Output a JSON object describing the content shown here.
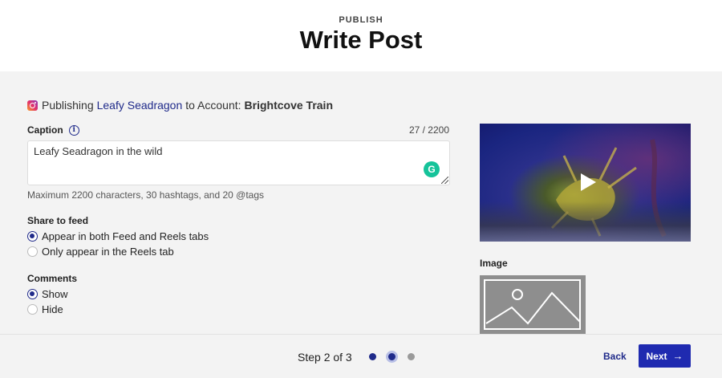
{
  "header": {
    "eyebrow": "PUBLISH",
    "title": "Write Post"
  },
  "publish_line": {
    "prefix": "Publishing",
    "video_name": "Leafy Seadragon",
    "middle": "to Account:",
    "account": "Brightcove Train"
  },
  "caption": {
    "label": "Caption",
    "info_icon": "i",
    "count": "27 / 2200",
    "value": "Leafy Seadragon in the wild",
    "grammarly_icon": "G",
    "helper": "Maximum 2200 characters, 30 hashtags, and 20 @tags"
  },
  "share_to_feed": {
    "label": "Share to feed",
    "options": [
      {
        "label": "Appear in both Feed and Reels tabs",
        "selected": true
      },
      {
        "label": "Only appear in the Reels tab",
        "selected": false
      }
    ]
  },
  "comments": {
    "label": "Comments",
    "options": [
      {
        "label": "Show",
        "selected": true
      },
      {
        "label": "Hide",
        "selected": false
      }
    ]
  },
  "media": {
    "image_label": "Image"
  },
  "footer": {
    "step_text": "Step 2 of 3",
    "current_step": 2,
    "total_steps": 3,
    "back_label": "Back",
    "next_label": "Next",
    "next_icon": "→"
  },
  "colors": {
    "accent": "#1f2a8a",
    "primary_button": "#1f2ab0",
    "grammarly": "#15c39a"
  }
}
